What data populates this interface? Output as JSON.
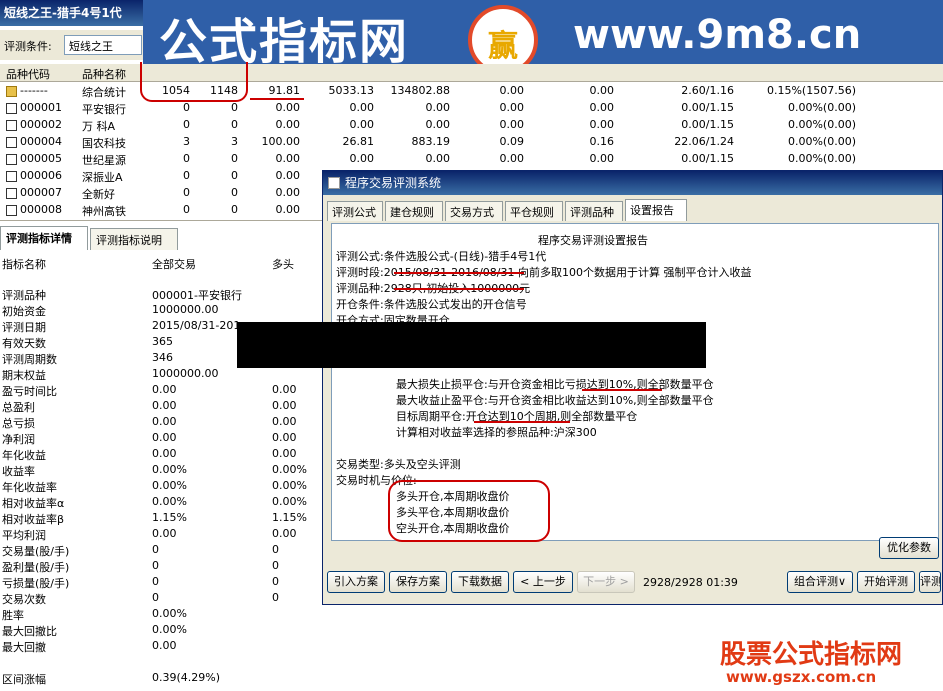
{
  "window": {
    "title": "短线之王-猎手4号1代"
  },
  "banner": {
    "left_text": "公式指标网",
    "logo_text": "赢",
    "right_text": "www.9m8.cn"
  },
  "toolbar": {
    "condition_label": "评测条件:",
    "condition_value": "短线之王"
  },
  "grid": {
    "headers": [
      "品种代码",
      "品种名称"
    ],
    "rows": [
      {
        "code": "-------",
        "name": "综合统计",
        "c1": "1054",
        "c2": "1148",
        "c3": "91.81",
        "c4": "5033.13",
        "c5": "134802.88",
        "c6": "0.00",
        "c7": "0.00",
        "c8": "2.60/1.16",
        "c9": "0.15%(1507.56)"
      },
      {
        "code": "000001",
        "name": "平安银行",
        "c1": "0",
        "c2": "0",
        "c3": "0.00",
        "c4": "0.00",
        "c5": "0.00",
        "c6": "0.00",
        "c7": "0.00",
        "c8": "0.00/1.15",
        "c9": "0.00%(0.00)"
      },
      {
        "code": "000002",
        "name": "万 科A",
        "c1": "0",
        "c2": "0",
        "c3": "0.00",
        "c4": "0.00",
        "c5": "0.00",
        "c6": "0.00",
        "c7": "0.00",
        "c8": "0.00/1.15",
        "c9": "0.00%(0.00)"
      },
      {
        "code": "000004",
        "name": "国农科技",
        "c1": "3",
        "c2": "3",
        "c3": "100.00",
        "c4": "26.81",
        "c5": "883.19",
        "c6": "0.09",
        "c7": "0.16",
        "c8": "22.06/1.24",
        "c9": "0.00%(0.00)"
      },
      {
        "code": "000005",
        "name": "世纪星源",
        "c1": "0",
        "c2": "0",
        "c3": "0.00",
        "c4": "0.00",
        "c5": "0.00",
        "c6": "0.00",
        "c7": "0.00",
        "c8": "0.00/1.15",
        "c9": "0.00%(0.00)"
      },
      {
        "code": "000006",
        "name": "深振业A",
        "c1": "0",
        "c2": "0",
        "c3": "0.00",
        "c4": "0.00",
        "c5": "0.00",
        "c6": "0.00",
        "c7": "0.00",
        "c8": "0.00/1.15",
        "c9": "0.00%(0.00)"
      },
      {
        "code": "000007",
        "name": "全新好",
        "c1": "0",
        "c2": "0",
        "c3": "0.00",
        "c4": "",
        "c5": "",
        "c6": "",
        "c7": "",
        "c8": "",
        "c9": ""
      },
      {
        "code": "000008",
        "name": "神州高铁",
        "c1": "0",
        "c2": "0",
        "c3": "0.00",
        "c4": "",
        "c5": "",
        "c6": "",
        "c7": "",
        "c8": "",
        "c9": ""
      }
    ]
  },
  "left_tabs": [
    "评测指标详情",
    "评测指标说明"
  ],
  "left_table": {
    "headers": [
      "指标名称",
      "全部交易",
      "多头"
    ],
    "rows": [
      {
        "name": "评测品种",
        "all": "000001-平安银行",
        "long": ""
      },
      {
        "name": "初始资金",
        "all": "1000000.00",
        "long": ""
      },
      {
        "name": "评测日期",
        "all": "2015/08/31-201",
        "long": ""
      },
      {
        "name": "有效天数",
        "all": "365",
        "long": ""
      },
      {
        "name": "评测周期数",
        "all": "346",
        "long": ""
      },
      {
        "name": "期末权益",
        "all": "1000000.00",
        "long": ""
      },
      {
        "name": "盈亏时间比",
        "all": "0.00",
        "long": "0.00"
      },
      {
        "name": "总盈利",
        "all": "0.00",
        "long": "0.00"
      },
      {
        "name": "总亏损",
        "all": "0.00",
        "long": "0.00"
      },
      {
        "name": "净利润",
        "all": "0.00",
        "long": "0.00"
      },
      {
        "name": "年化收益",
        "all": "0.00",
        "long": "0.00"
      },
      {
        "name": "收益率",
        "all": "0.00%",
        "long": "0.00%"
      },
      {
        "name": "年化收益率",
        "all": "0.00%",
        "long": "0.00%"
      },
      {
        "name": "相对收益率α",
        "all": "0.00%",
        "long": "0.00%"
      },
      {
        "name": "相对收益率β",
        "all": "1.15%",
        "long": "1.15%"
      },
      {
        "name": "平均利润",
        "all": "0.00",
        "long": "0.00"
      },
      {
        "name": "交易量(股/手)",
        "all": "0",
        "long": "0"
      },
      {
        "name": "盈利量(股/手)",
        "all": "0",
        "long": "0"
      },
      {
        "name": "亏损量(股/手)",
        "all": "0",
        "long": "0"
      },
      {
        "name": "交易次数",
        "all": "0",
        "long": "0"
      },
      {
        "name": "胜率",
        "all": "0.00%",
        "long": ""
      },
      {
        "name": "最大回撤比",
        "all": "0.00%",
        "long": ""
      },
      {
        "name": "最大回撤",
        "all": "0.00",
        "long": ""
      },
      {
        "name": "",
        "all": "",
        "long": ""
      },
      {
        "name": "区间涨幅",
        "all": "0.39(4.29%)",
        "long": ""
      }
    ]
  },
  "dialog": {
    "title": "程序交易评测系统",
    "tabs": [
      "评测公式",
      "建仓规则",
      "交易方式",
      "平仓规则",
      "评测品种",
      "设置报告"
    ],
    "report": {
      "heading": "程序交易评测设置报告",
      "lines": [
        "评测公式:条件选股公式-(日线)-猎手4号1代",
        "评测时段:2015/08/31-2016/08/31 向前多取100个数据用于计算 强制平仓计入收益",
        "评测品种:2928只,初始投入1000000元",
        "开仓条件:条件选股公式发出的开仓信号",
        "开仓方式:固定数量开仓",
        "最大损失止损平仓:与开仓资金相比亏损达到10%,则全部数量平仓",
        "最大收益止盈平仓:与开仓资金相比收益达到10%,则全部数量平仓",
        "目标周期平仓:开仓达到10个周期,则全部数量平仓",
        "计算相对收益率选择的参照品种:沪深300",
        "交易类型:多头及空头评测",
        "交易时机与价位:",
        "多头开仓,本周期收盘价",
        "多头平仓,本周期收盘价",
        "空头开仓,本周期收盘价"
      ]
    },
    "optimize_button": "优化参数",
    "buttons": {
      "import": "引入方案",
      "save": "保存方案",
      "download": "下载数据",
      "prev": "< 上一步",
      "next": "下一步 >",
      "status": "2928/2928 01:39",
      "combo_eval": "组合评测∨",
      "start_eval": "开始评测",
      "eval_cut": "评测"
    }
  },
  "watermark": {
    "line1": "股票公式指标网",
    "line2": "www.gszx.com.cn"
  }
}
